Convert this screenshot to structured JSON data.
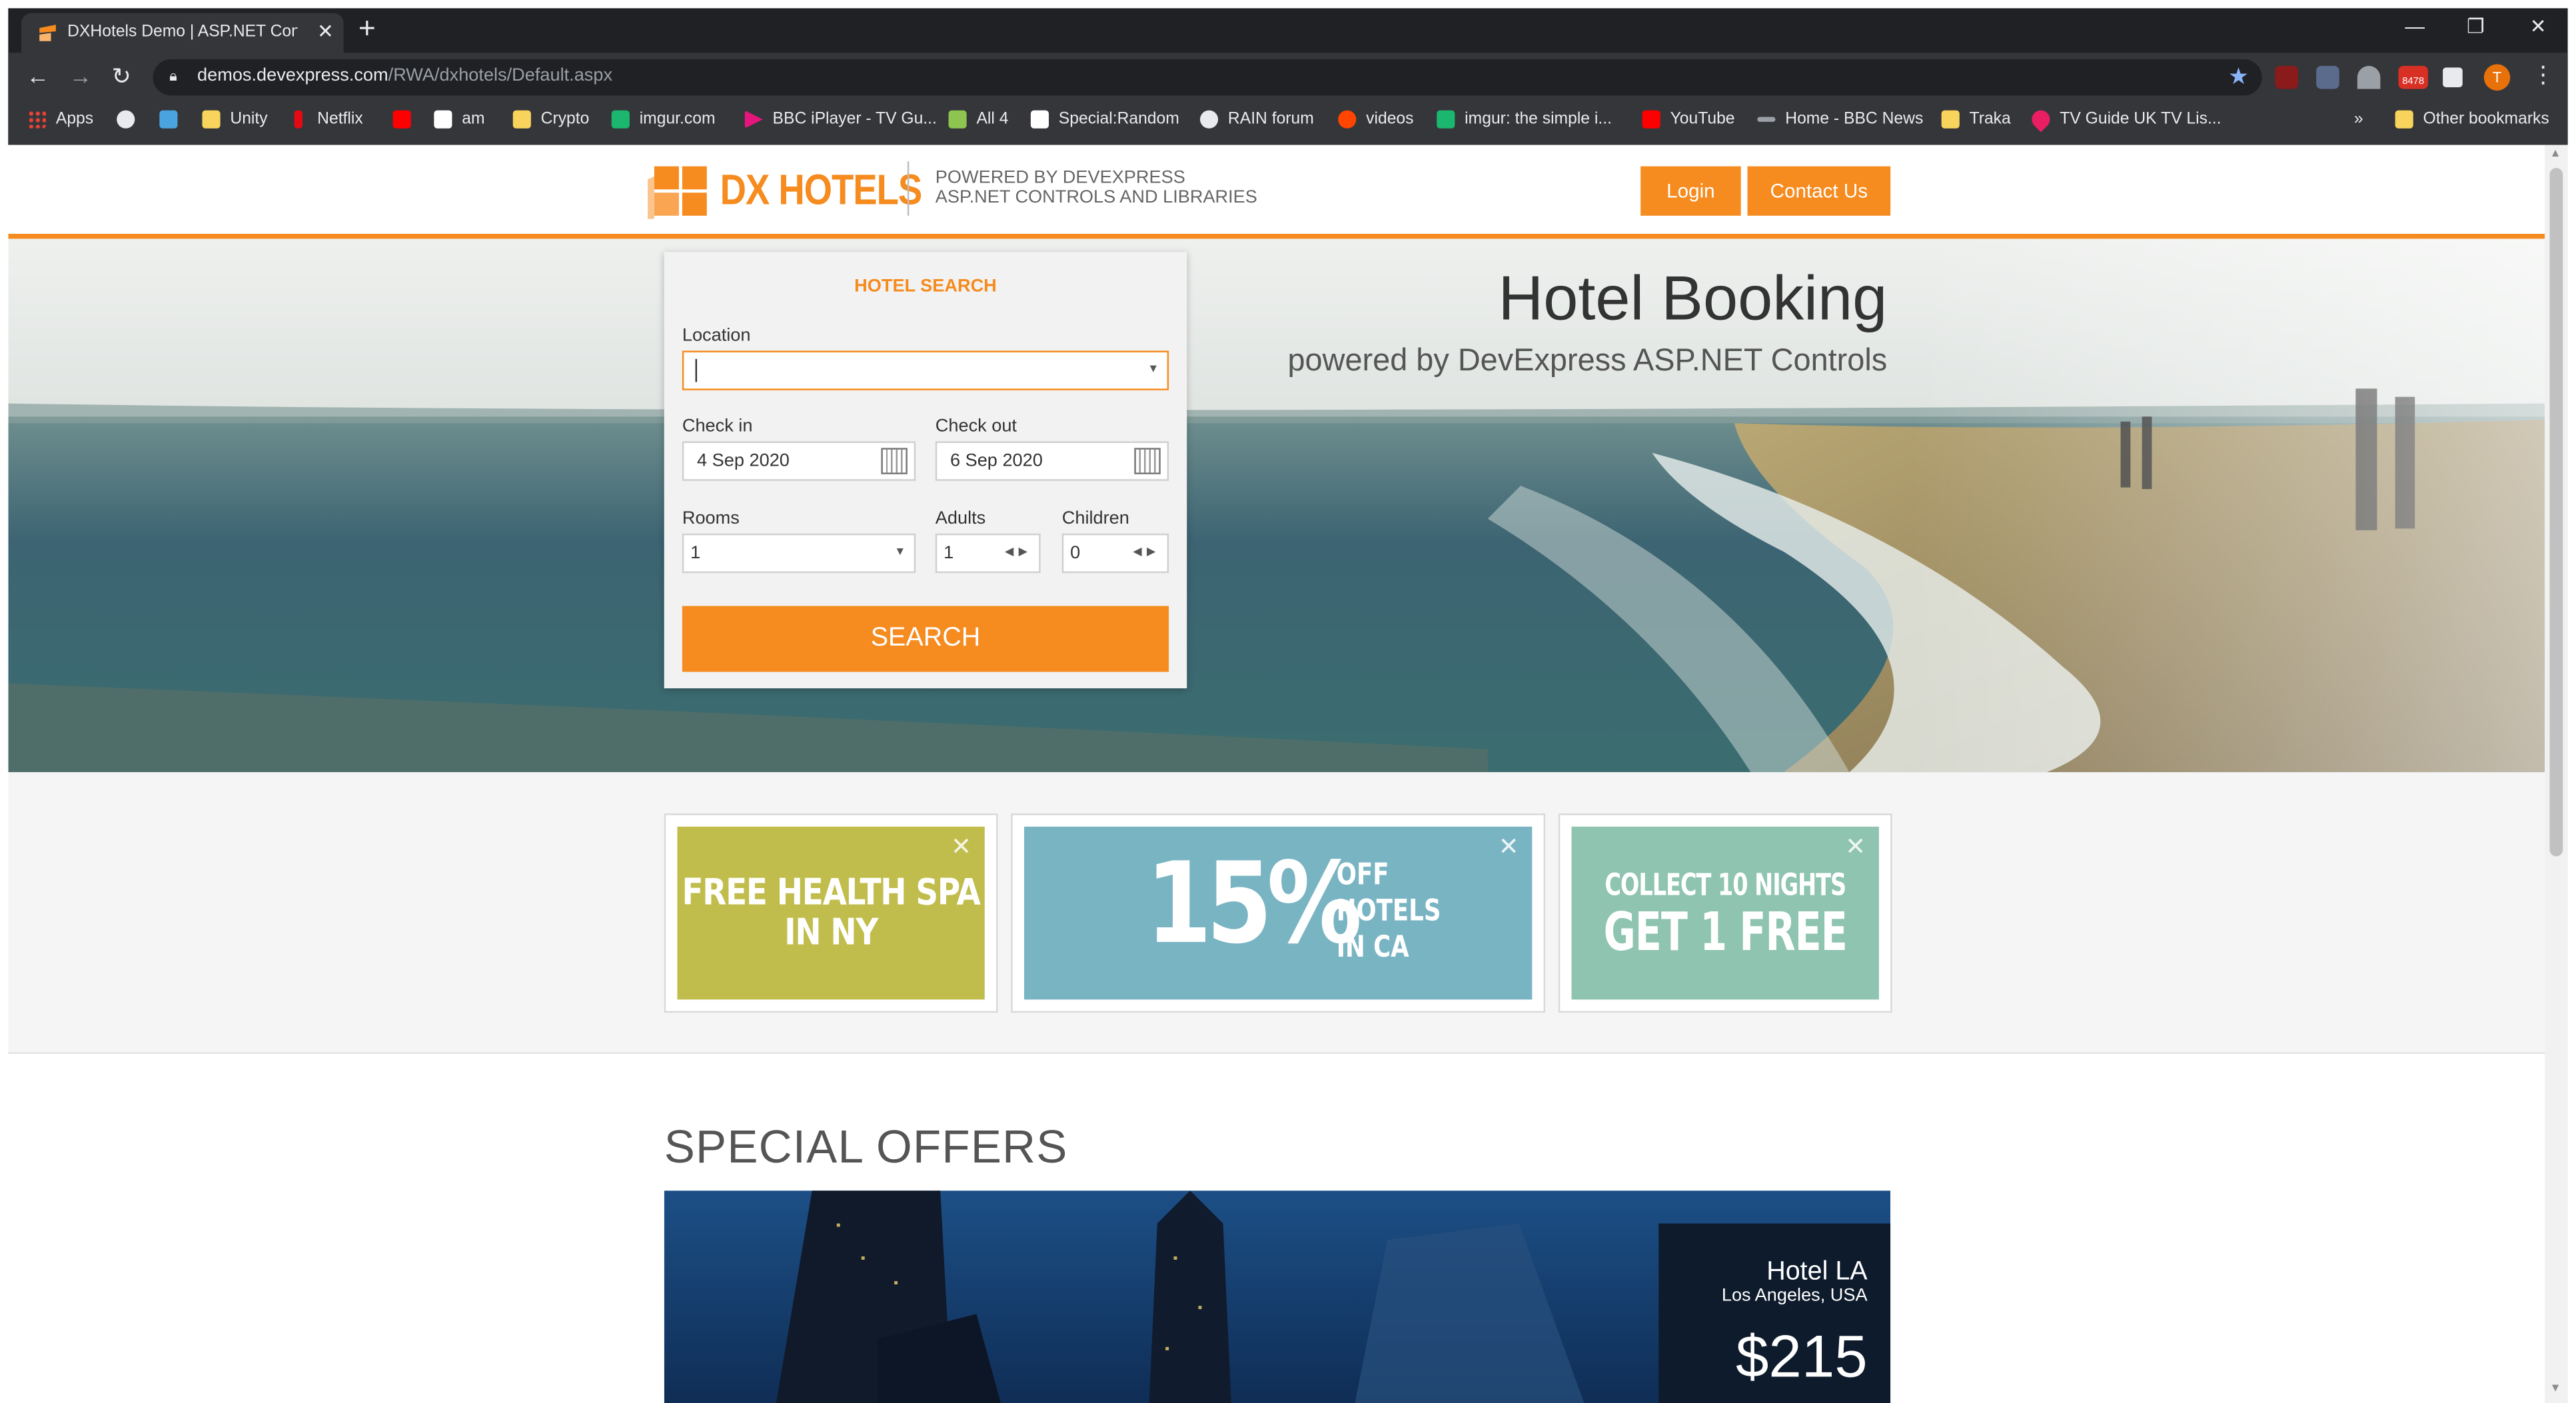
{
  "browser": {
    "tab_title": "DXHotels Demo | ASP.NET Contro",
    "url_host": "demos.devexpress.com",
    "url_path": "/RWA/dxhotels/Default.aspx",
    "profile_initial": "T",
    "gmail_count": "8478",
    "bookmarks": [
      "Apps",
      "Unity",
      "Netflix",
      "am",
      "Crypto",
      "imgur.com",
      "BBC iPlayer - TV Gu...",
      "All 4",
      "Special:Random",
      "RAIN forum",
      "videos",
      "imgur: the simple i...",
      "YouTube",
      "Home - BBC News",
      "Traka",
      "TV Guide UK TV Lis..."
    ],
    "bookmarks_overflow": "»",
    "other_bookmarks": "Other bookmarks"
  },
  "header": {
    "logo_text": "DX HOTELS",
    "tagline_line1": "POWERED BY DEVEXPRESS",
    "tagline_line2": "ASP.NET CONTROLS AND LIBRARIES",
    "login_label": "Login",
    "contact_label": "Contact Us"
  },
  "hero": {
    "title": "Hotel Booking",
    "subtitle": "powered by DevExpress ASP.NET Controls"
  },
  "search": {
    "title": "HOTEL SEARCH",
    "location_label": "Location",
    "location_value": "",
    "checkin_label": "Check in",
    "checkin_value": "4 Sep 2020",
    "checkout_label": "Check out",
    "checkout_value": "6 Sep 2020",
    "rooms_label": "Rooms",
    "rooms_value": "1",
    "adults_label": "Adults",
    "adults_value": "1",
    "children_label": "Children",
    "children_value": "0",
    "button_label": "SEARCH"
  },
  "promos": [
    {
      "line1": "FREE HEALTH SPA",
      "line2": "IN NY",
      "color": "#c1bd4c"
    },
    {
      "big": "15%",
      "line1": "OFF",
      "line2": "HOTELS",
      "line3": "IN CA",
      "color": "#79b4c3"
    },
    {
      "line1": "COLLECT 10 NIGHTS",
      "line2": "GET 1 FREE",
      "color": "#8ec4b0"
    }
  ],
  "offers": {
    "title": "SPECIAL OFFERS",
    "card": {
      "name": "Hotel LA",
      "location": "Los Angeles, USA",
      "price": "$215"
    }
  },
  "colors": {
    "accent": "#f68b1f",
    "chrome_dark": "#202124",
    "chrome_mid": "#35363a"
  }
}
